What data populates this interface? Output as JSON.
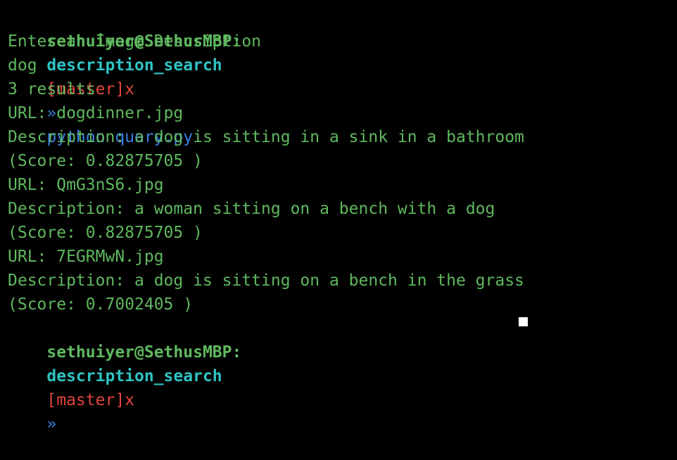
{
  "colors": {
    "background": "#000000",
    "output_text": "#5fb85f",
    "prompt_user": "#5fb85f",
    "prompt_dir": "#2fc2c2",
    "prompt_branch": "#e0453d",
    "prompt_command": "#3a7fe0"
  },
  "prompt": {
    "user_host": "sethuiyer@SethusMBP:",
    "directory": "description_search",
    "branch": "[master]",
    "dirty_mark": "x",
    "arrow": "»",
    "command": "python query.py"
  },
  "output": [
    "Enter an Image Description",
    "dog",
    "3 results",
    "URL: dogdinner.jpg",
    "Description: a dog is sitting in a sink in a bathroom",
    "(Score: 0.82875705 )",
    "URL: QmG3nS6.jpg",
    "Description: a woman sitting on a bench with a dog",
    "(Score: 0.82875705 )",
    "URL: 7EGRMwN.jpg",
    "Description: a dog is sitting on a bench in the grass",
    "(Score: 0.7002405 )"
  ],
  "next_prompt": {
    "user_host": "sethuiyer@SethusMBP:",
    "directory": "description_search",
    "branch": "[master]",
    "dirty_mark": "x",
    "arrow": "»"
  }
}
